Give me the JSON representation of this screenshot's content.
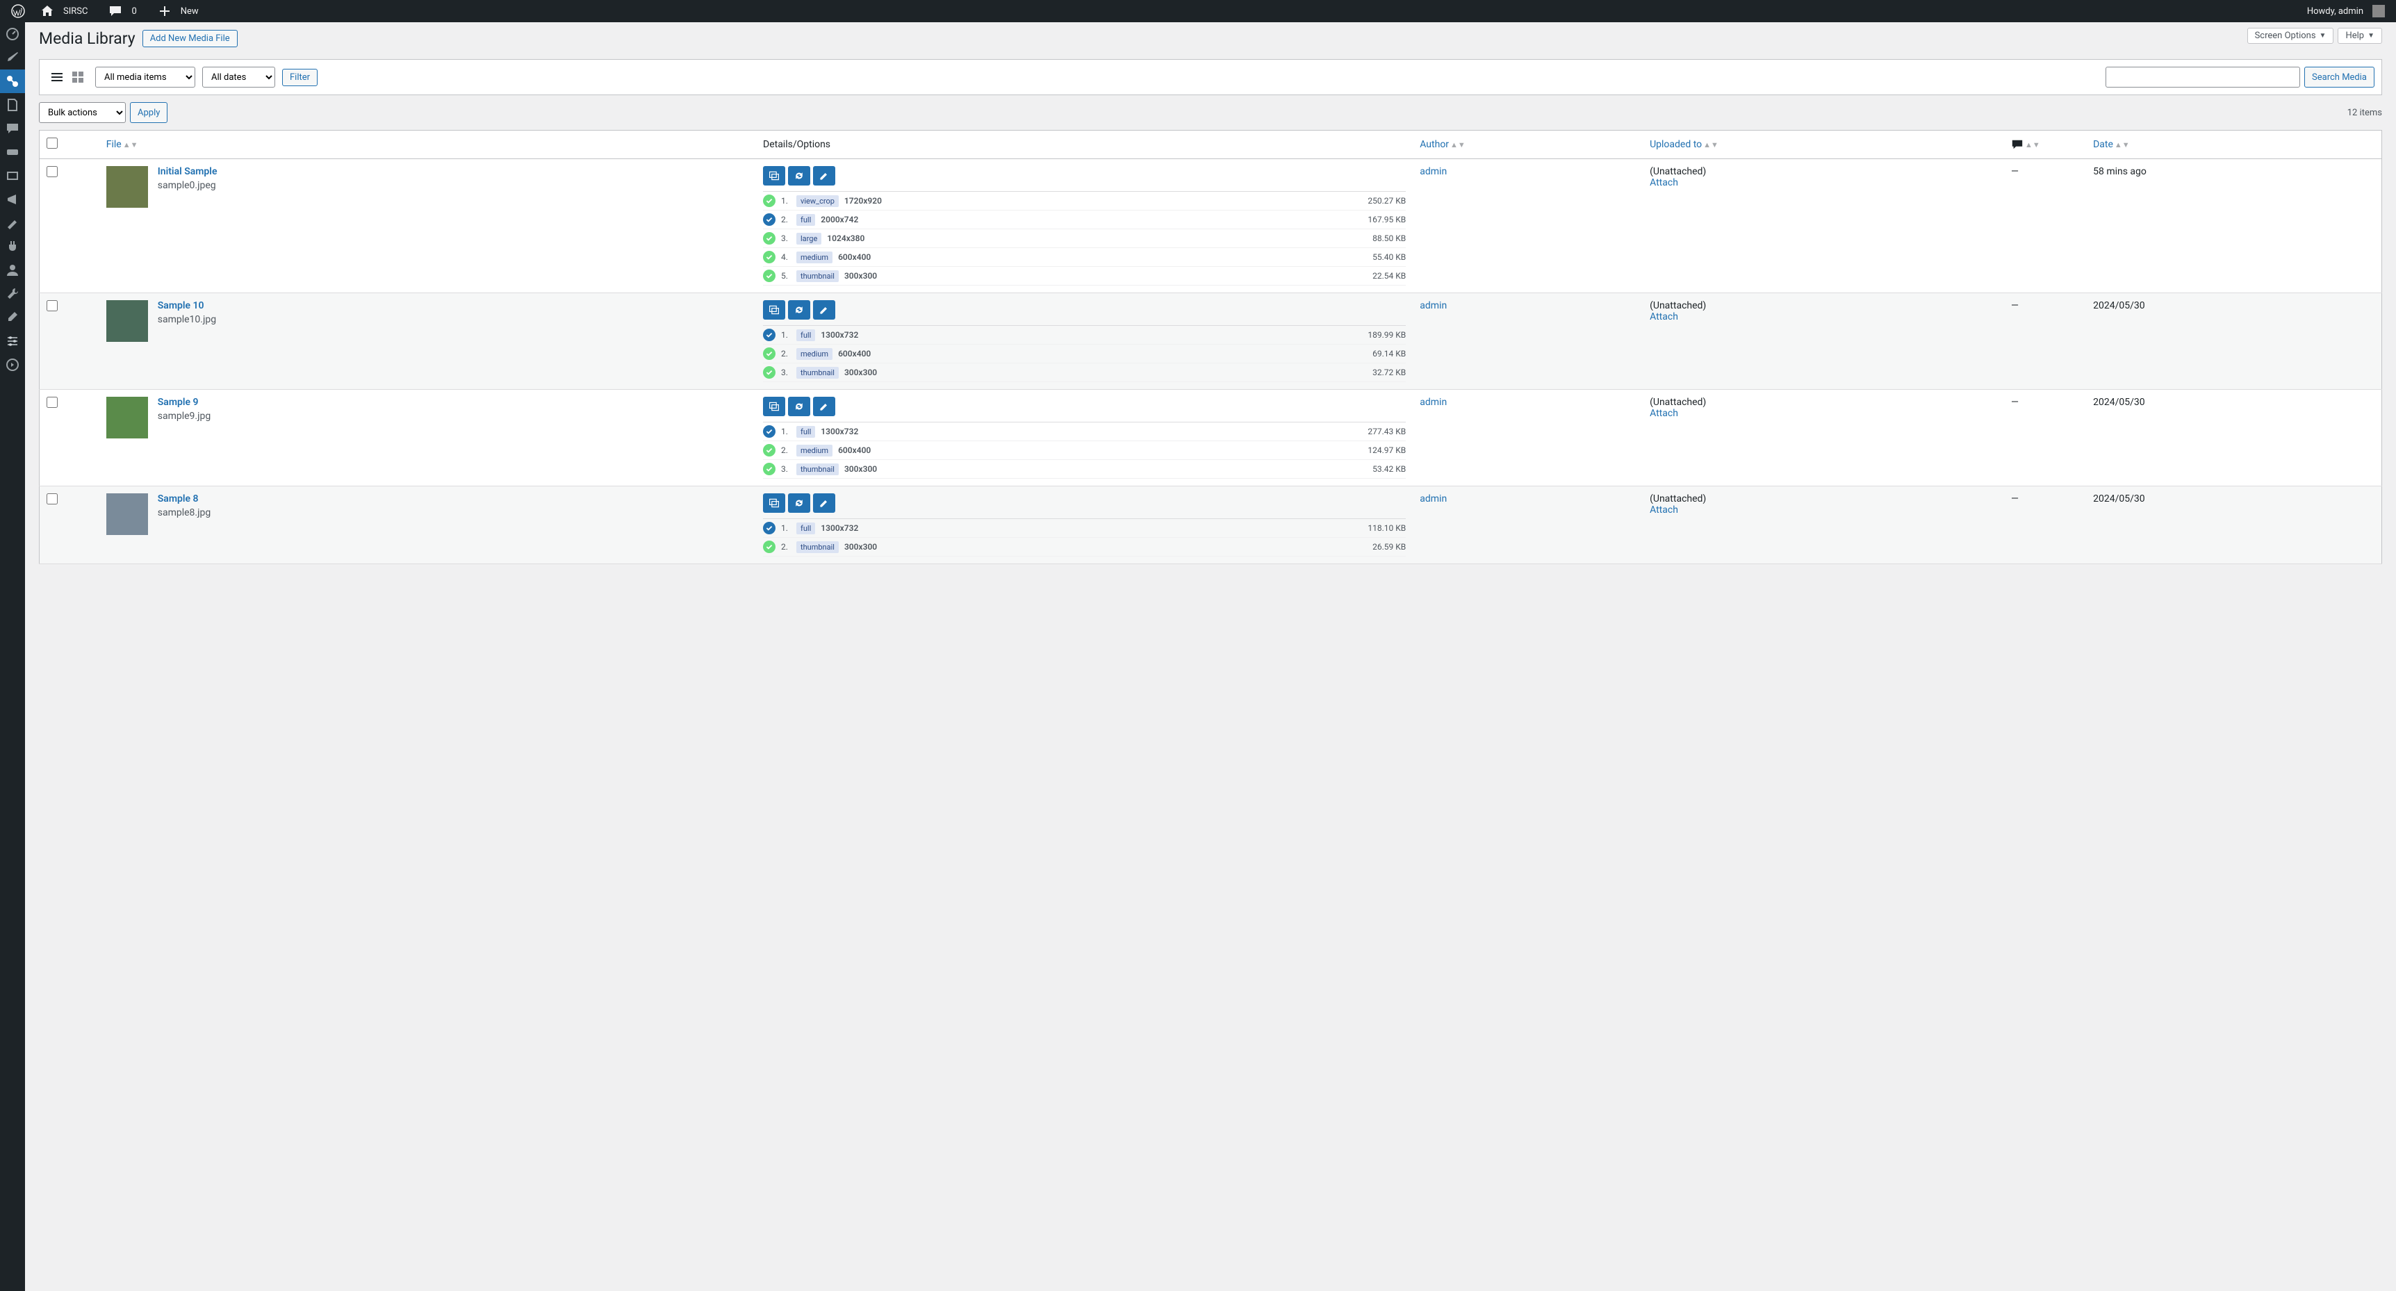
{
  "adminbar": {
    "site": "SIRSC",
    "comments": "0",
    "new": "New",
    "howdy": "Howdy, admin"
  },
  "topActions": {
    "screenOptions": "Screen Options",
    "help": "Help"
  },
  "page": {
    "title": "Media Library",
    "addNew": "Add New Media File"
  },
  "filters": {
    "mediaType": "All media items",
    "dates": "All dates",
    "filterBtn": "Filter",
    "searchBtn": "Search Media"
  },
  "bulk": {
    "label": "Bulk actions",
    "apply": "Apply",
    "count": "12 items"
  },
  "columns": {
    "file": "File",
    "details": "Details/Options",
    "author": "Author",
    "uploaded": "Uploaded to",
    "date": "Date"
  },
  "common": {
    "unattached": "(Unattached)",
    "attach": "Attach",
    "dash": "—"
  },
  "items": [
    {
      "title": "Initial Sample",
      "filename": "sample0.jpeg",
      "author": "admin",
      "date": "58 mins ago",
      "thumbColor": "#6b7a4a",
      "sizes": [
        {
          "n": "1.",
          "type": "green",
          "tag": "view_crop",
          "dim": "1720x920",
          "size": "250.27 KB"
        },
        {
          "n": "2.",
          "type": "blue",
          "tag": "full",
          "dim": "2000x742",
          "size": "167.95 KB"
        },
        {
          "n": "3.",
          "type": "green",
          "tag": "large",
          "dim": "1024x380",
          "size": "88.50 KB"
        },
        {
          "n": "4.",
          "type": "green",
          "tag": "medium",
          "dim": "600x400",
          "size": "55.40 KB"
        },
        {
          "n": "5.",
          "type": "green",
          "tag": "thumbnail",
          "dim": "300x300",
          "size": "22.54 KB"
        }
      ]
    },
    {
      "title": "Sample 10",
      "filename": "sample10.jpg",
      "author": "admin",
      "date": "2024/05/30",
      "thumbColor": "#4a6b5a",
      "sizes": [
        {
          "n": "1.",
          "type": "blue",
          "tag": "full",
          "dim": "1300x732",
          "size": "189.99 KB"
        },
        {
          "n": "2.",
          "type": "green",
          "tag": "medium",
          "dim": "600x400",
          "size": "69.14 KB"
        },
        {
          "n": "3.",
          "type": "green",
          "tag": "thumbnail",
          "dim": "300x300",
          "size": "32.72 KB"
        }
      ]
    },
    {
      "title": "Sample 9",
      "filename": "sample9.jpg",
      "author": "admin",
      "date": "2024/05/30",
      "thumbColor": "#5a8b4a",
      "sizes": [
        {
          "n": "1.",
          "type": "blue",
          "tag": "full",
          "dim": "1300x732",
          "size": "277.43 KB"
        },
        {
          "n": "2.",
          "type": "green",
          "tag": "medium",
          "dim": "600x400",
          "size": "124.97 KB"
        },
        {
          "n": "3.",
          "type": "green",
          "tag": "thumbnail",
          "dim": "300x300",
          "size": "53.42 KB"
        }
      ]
    },
    {
      "title": "Sample 8",
      "filename": "sample8.jpg",
      "author": "admin",
      "date": "2024/05/30",
      "thumbColor": "#7a8b9a",
      "sizes": [
        {
          "n": "1.",
          "type": "blue",
          "tag": "full",
          "dim": "1300x732",
          "size": "118.10 KB"
        },
        {
          "n": "2.",
          "type": "green",
          "tag": "thumbnail",
          "dim": "300x300",
          "size": "26.59 KB"
        }
      ]
    }
  ]
}
